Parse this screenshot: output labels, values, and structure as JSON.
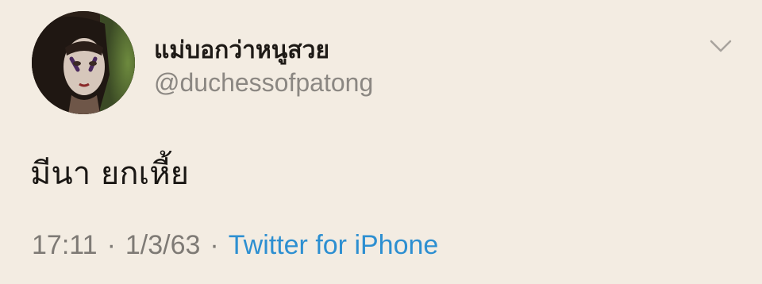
{
  "tweet": {
    "display_name": "แม่บอกว่าหนูสวย",
    "handle": "@duchessofpatong",
    "text": "มีนา ยกเหี้ย",
    "time": "17:11",
    "separator": "·",
    "date": "1/3/63",
    "source": "Twitter for iPhone"
  },
  "icons": {
    "avatar": "profile-photo",
    "menu": "chevron-down-icon"
  },
  "colors": {
    "background": "#f3ece2",
    "link": "#2d8fd1",
    "muted": "#7e7a75"
  }
}
